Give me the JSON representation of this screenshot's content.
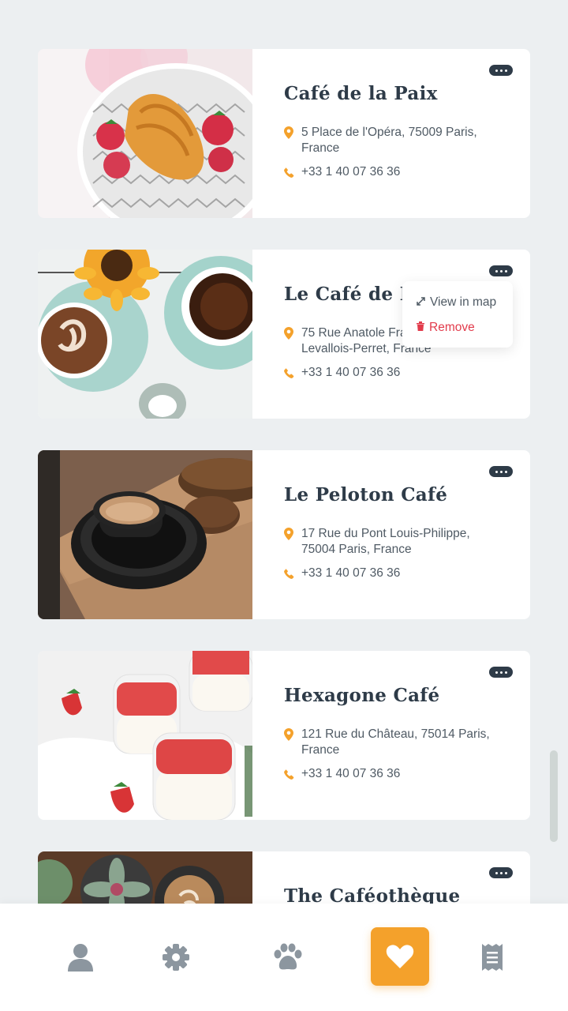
{
  "colors": {
    "background": "#eceff1",
    "card": "#ffffff",
    "title": "#2e3b48",
    "accent": "#f4a12b",
    "danger": "#e23b4b",
    "icon_muted": "#8c969f"
  },
  "cafes": [
    {
      "name": "Café de la Paix",
      "address": "5 Place de l'Opéra, 75009 Paris,",
      "address_line2": "France",
      "phone": "+33 1 40 07 36 36",
      "image": "croissant-strawberries-photo"
    },
    {
      "name": "Le Café de France",
      "address": "75 Rue Anatole France,",
      "address_line2": "Levallois-Perret, France",
      "phone": "+33 1 40 07 36 36",
      "image": "latte-sunflower-photo"
    },
    {
      "name": "Le Peloton Café",
      "address": "17 Rue du Pont Louis-Philippe,",
      "address_line2": "75004 Paris, France",
      "phone": "+33 1 40 07 36 36",
      "image": "espresso-cookies-photo"
    },
    {
      "name": "Hexagone Café",
      "address": "121 Rue du Château, 75014 Paris,",
      "address_line2": "France",
      "phone": "+33 1 40 07 36 36",
      "image": "strawberry-parfait-photo"
    },
    {
      "name": "The Caféothèque",
      "image": "succulent-latte-photo"
    }
  ],
  "context_menu": {
    "view_in_map": "View in map",
    "remove": "Remove"
  },
  "navbar": {
    "items": [
      "user-icon",
      "gear-icon",
      "paw-icon",
      "heart-icon",
      "receipt-icon"
    ],
    "active": "heart-icon"
  }
}
